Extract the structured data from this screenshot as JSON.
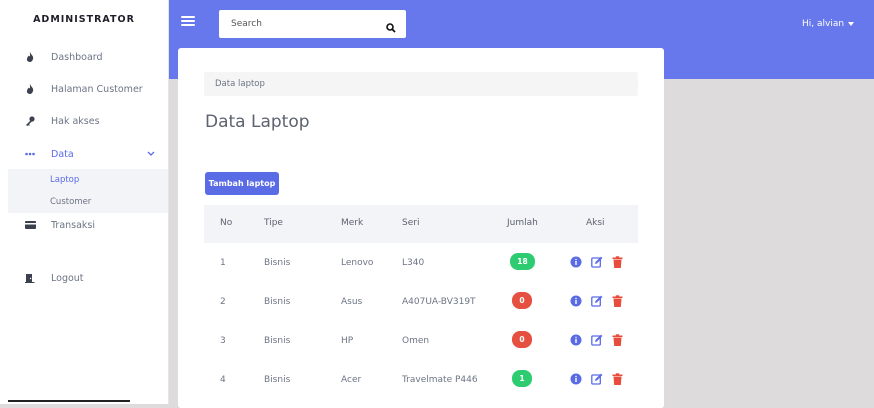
{
  "sidebar": {
    "brand": "ADMINISTRATOR",
    "items": [
      {
        "label": "Dashboard",
        "icon": "fire-icon"
      },
      {
        "label": "Halaman Customer",
        "icon": "fire-icon"
      },
      {
        "label": "Hak akses",
        "icon": "key-icon"
      },
      {
        "label": "Data",
        "icon": "dots-icon"
      },
      {
        "label": "Transaksi",
        "icon": "card-icon"
      },
      {
        "label": "Logout",
        "icon": "door-icon"
      }
    ],
    "submenu": [
      {
        "label": "Laptop"
      },
      {
        "label": "Customer"
      }
    ]
  },
  "topbar": {
    "search_placeholder": "Search",
    "user": "Hi, alvian"
  },
  "breadcrumb": "Data laptop",
  "title": "Data Laptop",
  "add_button": "Tambah laptop",
  "table": {
    "headers": [
      "No",
      "Tipe",
      "Merk",
      "Seri",
      "Jumlah",
      "Aksi"
    ],
    "rows": [
      {
        "no": "1",
        "tipe": "Bisnis",
        "merk": "Lenovo",
        "seri": "L340",
        "jumlah": "18"
      },
      {
        "no": "2",
        "tipe": "Bisnis",
        "merk": "Asus",
        "seri": "A407UA-BV319T",
        "jumlah": "0"
      },
      {
        "no": "3",
        "tipe": "Bisnis",
        "merk": "HP",
        "seri": "Omen",
        "jumlah": "0"
      },
      {
        "no": "4",
        "tipe": "Bisnis",
        "merk": "Acer",
        "seri": "Travelmate P446",
        "jumlah": "1"
      }
    ]
  },
  "colors": {
    "accent": "#6778ec",
    "badge_green": "#2ecc71",
    "badge_red": "#e55040",
    "delete": "#e74c3c"
  }
}
